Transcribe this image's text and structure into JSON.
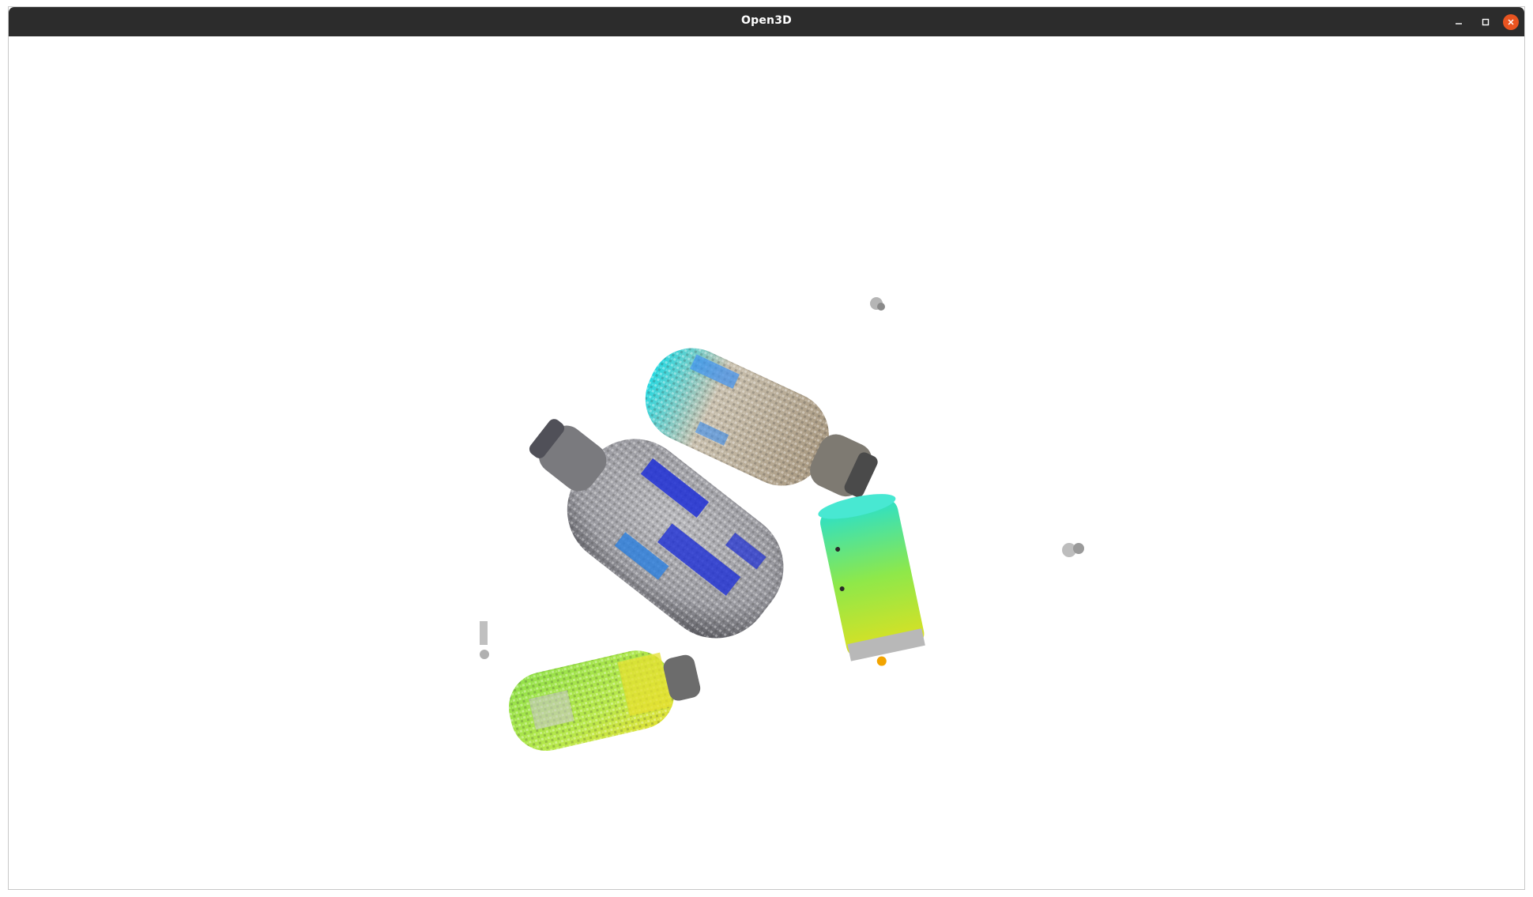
{
  "window": {
    "title": "Open3D",
    "controls": {
      "minimize": "minimize-icon",
      "maximize": "maximize-icon",
      "close": "close-icon"
    },
    "close_color": "#e95420",
    "titlebar_color": "#2c2c2c"
  },
  "scene": {
    "background": "#ffffff",
    "objects": [
      {
        "name": "large-bottle",
        "colors": [
          "#1e2fd6",
          "#a8a8a8",
          "#2a7fe0"
        ]
      },
      {
        "name": "upper-bottle",
        "colors": [
          "#c9c0ae",
          "#28d8e0",
          "#3a8ef0"
        ]
      },
      {
        "name": "small-bottle",
        "colors": [
          "#8ee04a",
          "#e6e030",
          "#c8c8c8"
        ]
      },
      {
        "name": "can",
        "colors": [
          "#2ce0c8",
          "#8ee84a",
          "#e0e020"
        ]
      }
    ]
  }
}
